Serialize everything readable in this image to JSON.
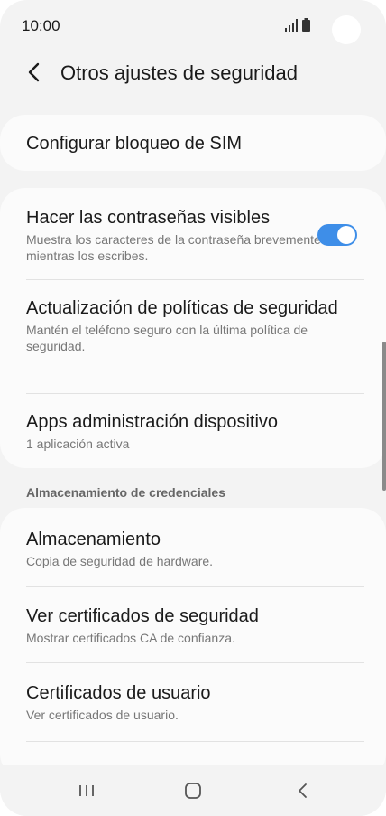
{
  "status_bar": {
    "time": "10:00",
    "signal_icon": "signal-icon",
    "battery_icon": "battery-icon"
  },
  "header": {
    "title": "Otros ajustes de seguridad",
    "back_icon": "back-arrow-icon"
  },
  "sim_card": {
    "title": "Configurar bloqueo de SIM"
  },
  "security_card": {
    "items": [
      {
        "title": "Hacer las contraseñas visibles",
        "subtitle": "Muestra los caracteres de la contraseña brevemente mientras los escribes.",
        "toggle": true
      },
      {
        "title": "Actualización de políticas de seguridad",
        "subtitle": "Mantén el teléfono seguro con la última política de seguridad."
      },
      {
        "title": "Apps administración dispositivo",
        "subtitle": "1 aplicación activa"
      }
    ]
  },
  "credentials": {
    "section_label": "Almacenamiento de credenciales",
    "items": [
      {
        "title": "Almacenamiento",
        "subtitle": "Copia de seguridad de hardware."
      },
      {
        "title": "Ver certificados de seguridad",
        "subtitle": "Mostrar certificados CA de confianza."
      },
      {
        "title": "Certificados de usuario",
        "subtitle": "Ver certificados de usuario."
      }
    ]
  },
  "nav_bar": {
    "icons": [
      "recent-apps-icon",
      "home-icon",
      "back-icon"
    ]
  },
  "colors": {
    "accent": "#3e8ee8",
    "background": "#f3f3f3",
    "card": "#fbfbfb"
  }
}
